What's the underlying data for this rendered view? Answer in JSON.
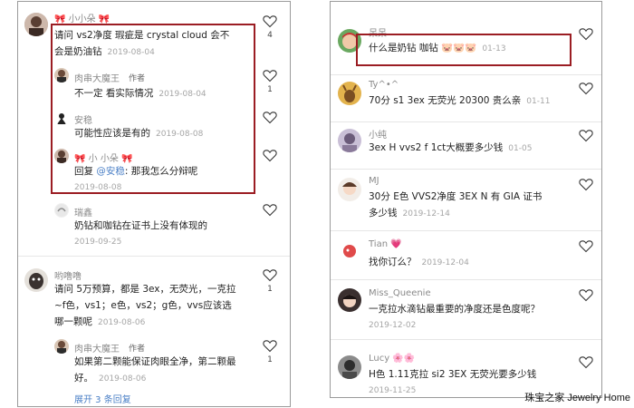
{
  "left": {
    "comments": [
      {
        "user": "小小朵",
        "text": "请问 vs2净度  瑕疵是 crystal cloud  会不",
        "text2": "会是奶油钻",
        "date": "2019-08-04",
        "likes": "4"
      },
      {
        "user": "肉串大魔王",
        "role": "作者",
        "text": "不一定 看实际情况",
        "date": "2019-08-04",
        "likes": "1"
      },
      {
        "user": "安稳",
        "text": "可能性应该是有的",
        "date": "2019-08-08"
      },
      {
        "user": "小 小朵",
        "text": "回复",
        "mention": "@安稳",
        "text_after": ": 那我怎么分辩呢",
        "date": "2019-08-08"
      },
      {
        "user": "瑞鑫",
        "text": "奶钻和咖钻在证书上没有体现的",
        "date": "2019-09-25"
      },
      {
        "user": "哟噜噜",
        "text": "请问 5万预算，都是 3ex，无荧光，一克拉",
        "text2": "~f色，vs1；e色，vs2；g色，vvs应该选",
        "text3": "哪一颗呢",
        "date": "2019-08-06",
        "likes": "1"
      },
      {
        "user": "肉串大魔王",
        "role": "作者",
        "text": "如果第二颗能保证肉眼全净，第二颗最",
        "text2": "好。",
        "date": "2019-08-06",
        "likes": "1"
      }
    ],
    "expand_label": "展开 3 条回复"
  },
  "right": {
    "comments": [
      {
        "user": "呆呆",
        "text": "什么是奶钻 咖钻",
        "emoji": "🐷🐷🐷",
        "date": "01-13"
      },
      {
        "user": "Ty^•^",
        "text": "70分 s1 3ex  无荧光 20300 贵么亲",
        "date": "01-11"
      },
      {
        "user": "小纯",
        "text": "3ex H vvs2  f 1ct大概要多少钱",
        "date": "01-05"
      },
      {
        "user": "MJ",
        "text": "30分 E色 VVS2净度 3EX N 有 GIA 证书",
        "text2": "多少钱",
        "date": "2019-12-14"
      },
      {
        "user": "Tian",
        "text": "找你订么？",
        "date": "2019-12-04"
      },
      {
        "user": "Miss_Queenie",
        "text": "一克拉水滴钻最重要的净度还是色度呢？",
        "date": "2019-12-02"
      },
      {
        "user": "Lucy",
        "text": "H色 1.11克拉 si2 3EX 无荧光要多少钱",
        "date": "2019-11-25"
      }
    ]
  },
  "watermark": {
    "cn": "珠宝之家",
    "en": "Jewelry Home"
  },
  "colors": {
    "highlight_box": "#9b1d23",
    "link": "#4a7fc6",
    "pink": "#e8779a",
    "date": "#a6a6a6"
  }
}
